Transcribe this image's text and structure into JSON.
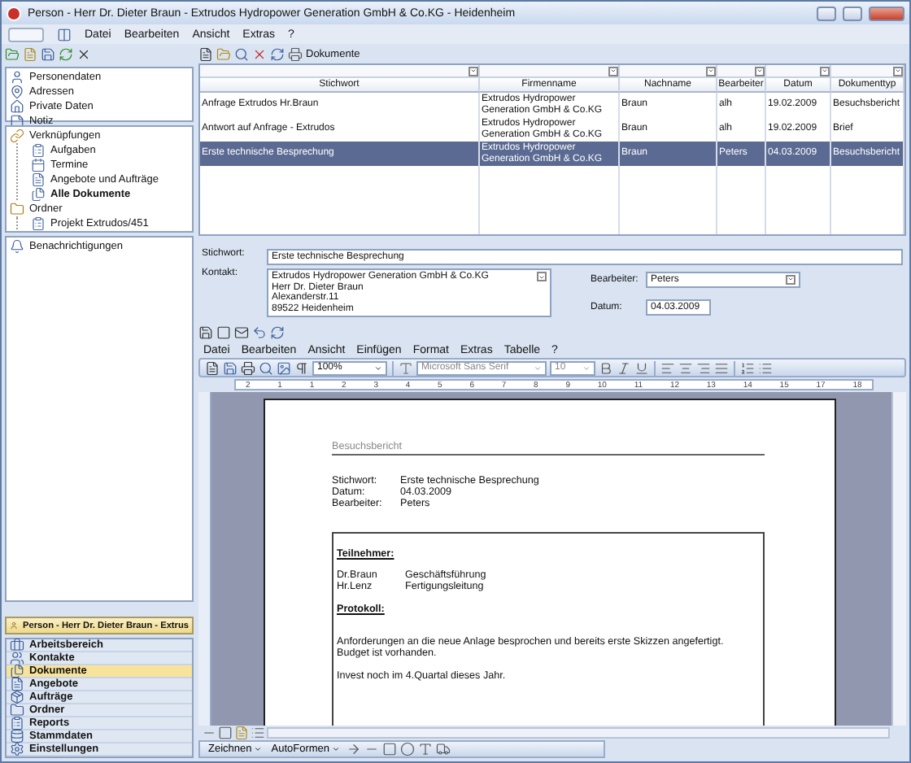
{
  "window": {
    "title": "Person - Herr Dr. Dieter Braun - Extrudos Hydropower Generation GmbH & Co.KG - Heidenheim"
  },
  "menu": [
    "Datei",
    "Bearbeiten",
    "Ansicht",
    "Extras",
    "?"
  ],
  "sidebar": {
    "contact_items": [
      "Personendaten",
      "Adressen",
      "Private Daten",
      "Notiz"
    ],
    "tree": [
      {
        "label": "Verknüpfungen",
        "selected": false,
        "children": [
          {
            "label": "Aufgaben",
            "selected": false
          },
          {
            "label": "Termine",
            "selected": false
          },
          {
            "label": "Angebote und Aufträge",
            "selected": false
          },
          {
            "label": "Alle Dokumente",
            "selected": true
          }
        ]
      },
      {
        "label": "Ordner",
        "selected": false,
        "children": [
          {
            "label": "Projekt Extrudos/451",
            "selected": false
          }
        ]
      }
    ],
    "notifications": "Benachrichtigungen"
  },
  "nav": {
    "header": "Person - Herr Dr. Dieter Braun - Extrus",
    "items": [
      {
        "label": "Arbeitsbereich",
        "selected": false
      },
      {
        "label": "Kontakte",
        "selected": false
      },
      {
        "label": "Dokumente",
        "selected": true
      },
      {
        "label": "Angebote",
        "selected": false
      },
      {
        "label": "Aufträge",
        "selected": false
      },
      {
        "label": "Ordner",
        "selected": false
      },
      {
        "label": "Reports",
        "selected": false
      },
      {
        "label": "Stammdaten",
        "selected": false
      },
      {
        "label": "Einstellungen",
        "selected": false
      }
    ]
  },
  "documents": {
    "toolbar_label": "Dokumente",
    "columns": [
      "Stichwort",
      "Firmenname",
      "Nachname",
      "Bearbeiter",
      "Datum",
      "Dokumenttyp"
    ],
    "rows": [
      {
        "selected": false,
        "cells": [
          "Anfrage Extrudos Hr.Braun",
          "Extrudos Hydropower Generation GmbH & Co.KG",
          "Braun",
          "alh",
          "19.02.2009",
          "Besuchsbericht"
        ]
      },
      {
        "selected": false,
        "cells": [
          "Antwort auf Anfrage - Extrudos",
          "Extrudos Hydropower Generation GmbH & Co.KG",
          "Braun",
          "alh",
          "19.02.2009",
          "Brief"
        ]
      },
      {
        "selected": true,
        "cells": [
          "Erste technische Besprechung",
          "Extrudos Hydropower Generation GmbH & Co.KG",
          "Braun",
          "Peters",
          "04.03.2009",
          "Besuchsbericht"
        ]
      }
    ]
  },
  "form": {
    "keyword_label": "Stichwort:",
    "keyword": "Erste technische Besprechung",
    "contact_label": "Kontakt:",
    "contact_lines": [
      "Extrudos Hydropower Generation GmbH & Co.KG",
      "Herr Dr. Dieter Braun",
      "Alexanderstr.11",
      "89522 Heidenheim"
    ],
    "editor_label": "Bearbeiter:",
    "editor": "Peters",
    "date_label": "Datum:",
    "date": "04.03.2009"
  },
  "editor": {
    "menu": [
      "Datei",
      "Bearbeiten",
      "Ansicht",
      "Einfügen",
      "Format",
      "Extras",
      "Tabelle",
      "?"
    ],
    "zoom": "100%",
    "font": "Microsoft Sans Serif",
    "size": "10",
    "ruler": [
      "2",
      "1",
      "1",
      "2",
      "3",
      "4",
      "5",
      "6",
      "7",
      "8",
      "9",
      "10",
      "11",
      "12",
      "13",
      "14",
      "15",
      "17",
      "18"
    ]
  },
  "document": {
    "heading": "Besuchsbericht",
    "fields": [
      {
        "label": "Stichwort:",
        "value": "Erste technische Besprechung"
      },
      {
        "label": "Datum:",
        "value": "04.03.2009"
      },
      {
        "label": "Bearbeiter:",
        "value": "Peters"
      }
    ],
    "participants_title": "Teilnehmer:",
    "participants": [
      {
        "name": "Dr.Braun",
        "role": "Geschäftsführung"
      },
      {
        "name": "Hr.Lenz",
        "role": "Fertigungsleitung"
      }
    ],
    "protocol_title": "Protokoll:",
    "paragraphs": [
      [
        "Anforderungen an die neue Anlage besprochen und bereits erste Skizzen angefertigt.",
        "Budget ist vorhanden."
      ],
      [
        "Invest noch im 4.Quartal dieses Jahr."
      ]
    ]
  },
  "draw_toolbar": [
    "Zeichnen",
    "AutoFormen"
  ]
}
